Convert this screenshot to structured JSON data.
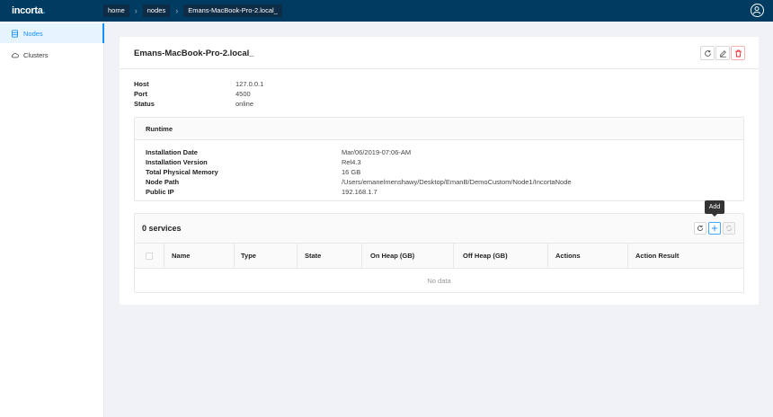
{
  "app": {
    "logo_text": "incorta",
    "logo_dot": "."
  },
  "breadcrumb": [
    "home",
    "nodes",
    "Emans-MacBook-Pro-2.local_"
  ],
  "sidebar": {
    "items": [
      {
        "label": "Nodes",
        "icon": "nodes-icon",
        "active": true
      },
      {
        "label": "Clusters",
        "icon": "cloud-icon",
        "active": false
      }
    ]
  },
  "node": {
    "title": "Emans-MacBook-Pro-2.local_",
    "fields": [
      {
        "key": "Host",
        "value": "127.0.0.1"
      },
      {
        "key": "Port",
        "value": "4500"
      },
      {
        "key": "Status",
        "value": "online"
      }
    ]
  },
  "runtime": {
    "title": "Runtime",
    "fields": [
      {
        "key": "Installation Date",
        "value": "Mar/06/2019-07:06-AM"
      },
      {
        "key": "Installation Version",
        "value": "Rel4.3"
      },
      {
        "key": "Total Physical Memory",
        "value": "16 GB"
      },
      {
        "key": "Node Path",
        "value": "/Users/emanelmenshawy/Desktop/EmanB/DemoCustom/Node1/IncortaNode"
      },
      {
        "key": "Public IP",
        "value": "192.168.1.7"
      }
    ]
  },
  "services": {
    "title": "0 services",
    "tooltip": "Add",
    "columns": [
      "Name",
      "Type",
      "State",
      "On Heap (GB)",
      "Off Heap (GB)",
      "Actions",
      "Action Result"
    ],
    "empty_text": "No data"
  },
  "colors": {
    "topbar": "#003c61",
    "accent": "#1890ff",
    "danger": "#f5222d"
  }
}
